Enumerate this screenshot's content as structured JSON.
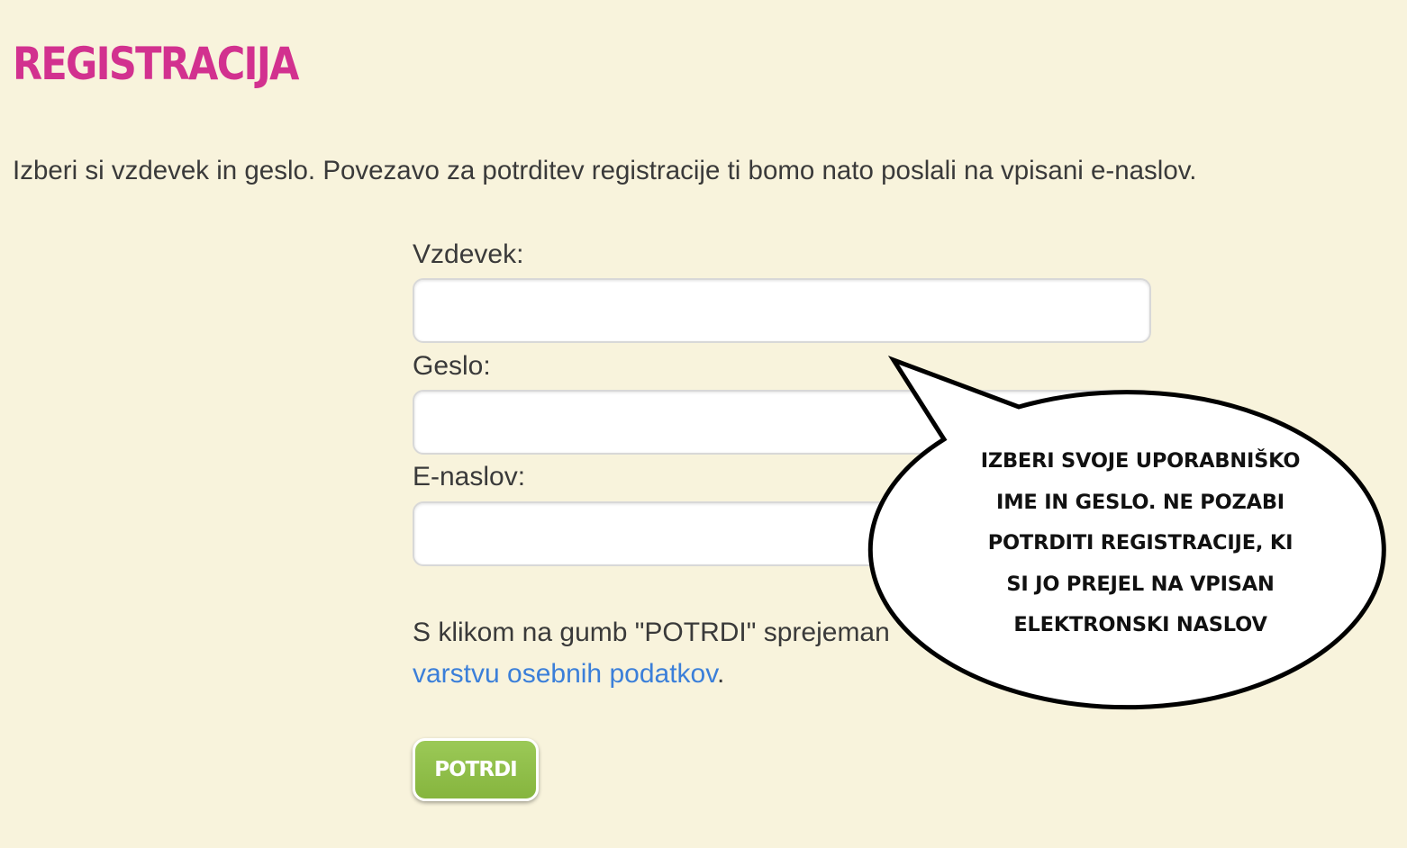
{
  "page": {
    "title": "REGISTRACIJA",
    "intro": "Izberi si vzdevek in geslo. Povezavo za potrditev registracije ti bomo nato poslali na vpisani e-naslov."
  },
  "form": {
    "nickname_label": "Vzdevek:",
    "nickname_value": "",
    "password_label": "Geslo:",
    "password_value": "",
    "email_label": "E-naslov:",
    "email_value": "",
    "terms_text": "S klikom na gumb \"POTRDI\" sprejeman",
    "privacy_link": "varstvu osebnih podatkov",
    "privacy_link_suffix": ".",
    "submit_label": "POTRDI"
  },
  "callout": {
    "lines": [
      "IZBERI SVOJE UPORABNIŠKO",
      "IME IN GESLO. NE POZABI",
      "POTRDITI REGISTRACIJE, KI",
      "SI JO PREJEL NA VPISAN",
      "ELEKTRONSKI NASLOV"
    ]
  },
  "colors": {
    "background": "#f8f3dc",
    "title": "#d2318f",
    "link": "#3b7fd9",
    "button": "#8fbf4a",
    "text": "#3a3a3a"
  }
}
